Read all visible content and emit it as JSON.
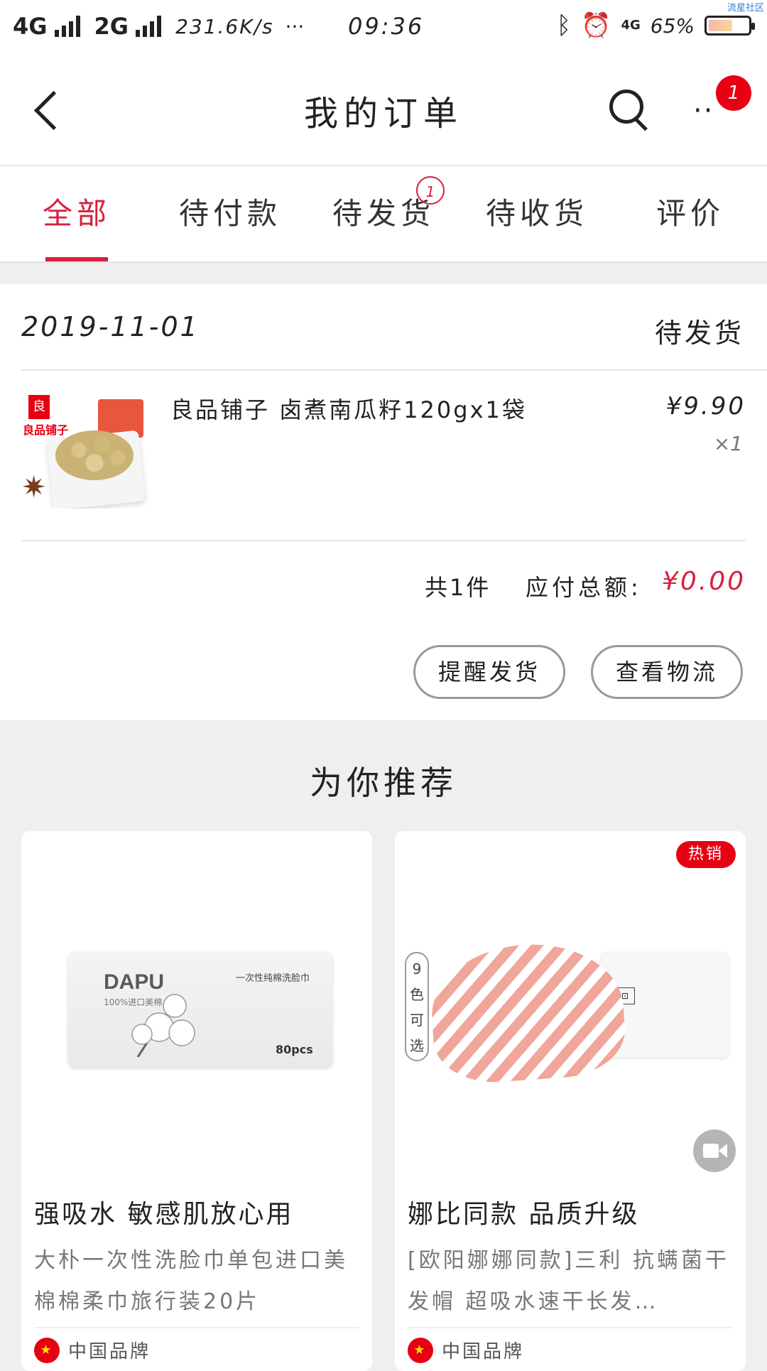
{
  "status_bar": {
    "network1": "4G",
    "network2": "2G",
    "speed": "231.6K/s",
    "more": "···",
    "time": "09:36",
    "signal_4g": "4G",
    "battery": "65%",
    "battery_level": 0.65,
    "watermark": "流星社区"
  },
  "header": {
    "title": "我的订单",
    "badge_count": "1"
  },
  "tabs": [
    {
      "label": "全部",
      "active": true
    },
    {
      "label": "待付款"
    },
    {
      "label": "待发货",
      "badge": "1"
    },
    {
      "label": "待收货"
    },
    {
      "label": "评价"
    }
  ],
  "order": {
    "date": "2019-11-01",
    "status": "待发货",
    "product": {
      "name": "良品铺子 卤煮南瓜籽120gx1袋",
      "price": "¥9.90",
      "quantity": "×1",
      "thumb_brand": "良品铺子",
      "thumb_logo": "良"
    },
    "count_text": "共1件",
    "total_label": "应付总额:",
    "total_amount": "¥0.00",
    "buttons": {
      "remind": "提醒发货",
      "logistics": "查看物流"
    }
  },
  "recommend": {
    "title": "为你推荐",
    "items": [
      {
        "headline": "强吸水 敏感肌放心用",
        "description": "大朴一次性洗脸巾单包进口美棉棉柔巾旅行装20片",
        "origin": "中国品牌",
        "pack_brand": "DAPU",
        "pack_sub": "100%进口美棉",
        "pack_title": "一次性纯棉洗脸巾",
        "pack_count": "80pcs"
      },
      {
        "headline": "娜比同款 品质升级",
        "description": "[欧阳娜娜同款]三利 抗螨菌干发帽 超吸水速干长发…",
        "origin": "中国品牌",
        "hot_badge": "热销",
        "color_tag": "9色可选"
      }
    ]
  },
  "icons": {
    "back": "back-arrow-icon",
    "search": "search-icon",
    "more": "more-icon",
    "video": "video-icon",
    "flag": "china-flag-icon"
  },
  "colors": {
    "accent": "#d6203c",
    "badge_red": "#e60012"
  }
}
